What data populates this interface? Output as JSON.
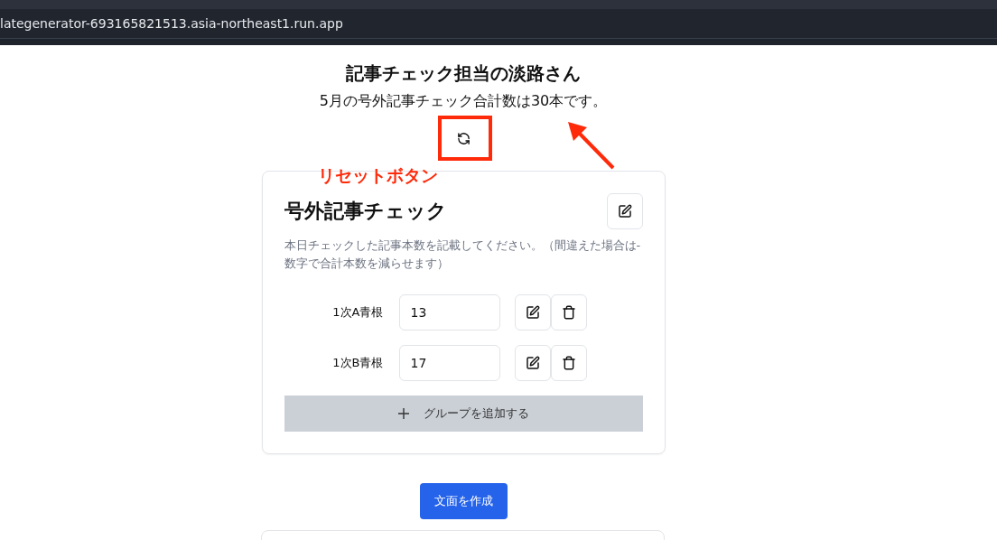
{
  "browser": {
    "url": "lategenerator-693165821513.asia-northeast1.run.app"
  },
  "header": {
    "title": "記事チェック担当の淡路さん",
    "summary": "5月の号外記事チェック合計数は30本です。"
  },
  "card": {
    "title": "号外記事チェック",
    "description": "本日チェックした記事本数を記載してください。（間違えた場合は-数字で合計本数を減らせます）",
    "groups": [
      {
        "label": "1次A青根",
        "value": "13"
      },
      {
        "label": "1次B青根",
        "value": "17"
      }
    ],
    "add_button": "グループを追加する"
  },
  "generate_button": "文面を作成",
  "annotations": [
    {
      "kind": "box"
    },
    {
      "kind": "arrow"
    },
    {
      "kind": "label",
      "text": "リセットボタン"
    }
  ]
}
